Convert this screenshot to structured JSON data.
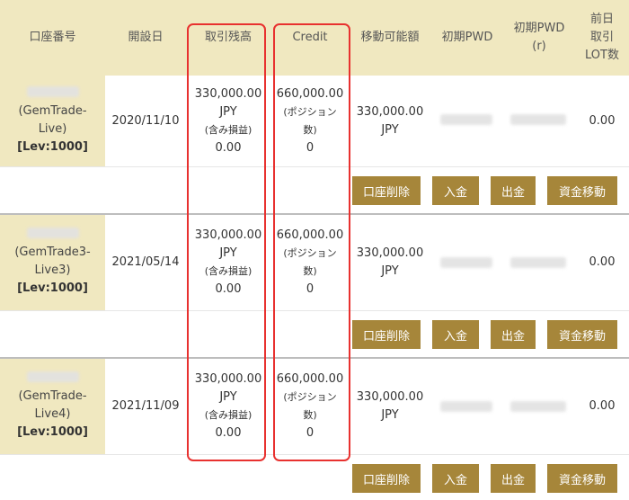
{
  "header": {
    "account_no": "口座番号",
    "open_date": "開設日",
    "balance": "取引残高",
    "credit": "Credit",
    "transferable": "移動可能額",
    "initial_pwd": "初期PWD",
    "initial_pwd_r_1": "初期PWD",
    "initial_pwd_r_2": "(r)",
    "prev_lot_1": "前日",
    "prev_lot_2": "取引",
    "prev_lot_3": "LOT数"
  },
  "rows": [
    {
      "account_name_1": "(GemTrade-Live)",
      "account_name_2": "",
      "leverage": "[Lev:1000]",
      "open_date": "2020/11/10",
      "balance": "330,000.00",
      "balance_currency": "JPY",
      "balance_note": "(含み損益)",
      "balance_pl": "0.00",
      "credit": "660,000.00",
      "credit_note_1": "(ポジション",
      "credit_note_2": "数)",
      "credit_positions": "0",
      "transferable": "330,000.00",
      "transferable_currency": "JPY",
      "prev_lot": "0.00"
    },
    {
      "account_name_1": "(GemTrade3-",
      "account_name_2": "Live3)",
      "leverage": "[Lev:1000]",
      "open_date": "2021/05/14",
      "balance": "330,000.00",
      "balance_currency": "JPY",
      "balance_note": "(含み損益)",
      "balance_pl": "0.00",
      "credit": "660,000.00",
      "credit_note_1": "(ポジション",
      "credit_note_2": "数)",
      "credit_positions": "0",
      "transferable": "330,000.00",
      "transferable_currency": "JPY",
      "prev_lot": "0.00"
    },
    {
      "account_name_1": "(GemTrade-",
      "account_name_2": "Live4)",
      "leverage": "[Lev:1000]",
      "open_date": "2021/11/09",
      "balance": "330,000.00",
      "balance_currency": "JPY",
      "balance_note": "(含み損益)",
      "balance_pl": "0.00",
      "credit": "660,000.00",
      "credit_note_1": "(ポジション",
      "credit_note_2": "数)",
      "credit_positions": "0",
      "transferable": "330,000.00",
      "transferable_currency": "JPY",
      "prev_lot": "0.00"
    }
  ],
  "actions": {
    "delete_account": "口座削除",
    "deposit": "入金",
    "withdraw": "出金",
    "transfer": "資金移動"
  },
  "colors": {
    "header_bg": "#f0e8c0",
    "button_bg": "#a6863a",
    "highlight_border": "#e8312f"
  }
}
